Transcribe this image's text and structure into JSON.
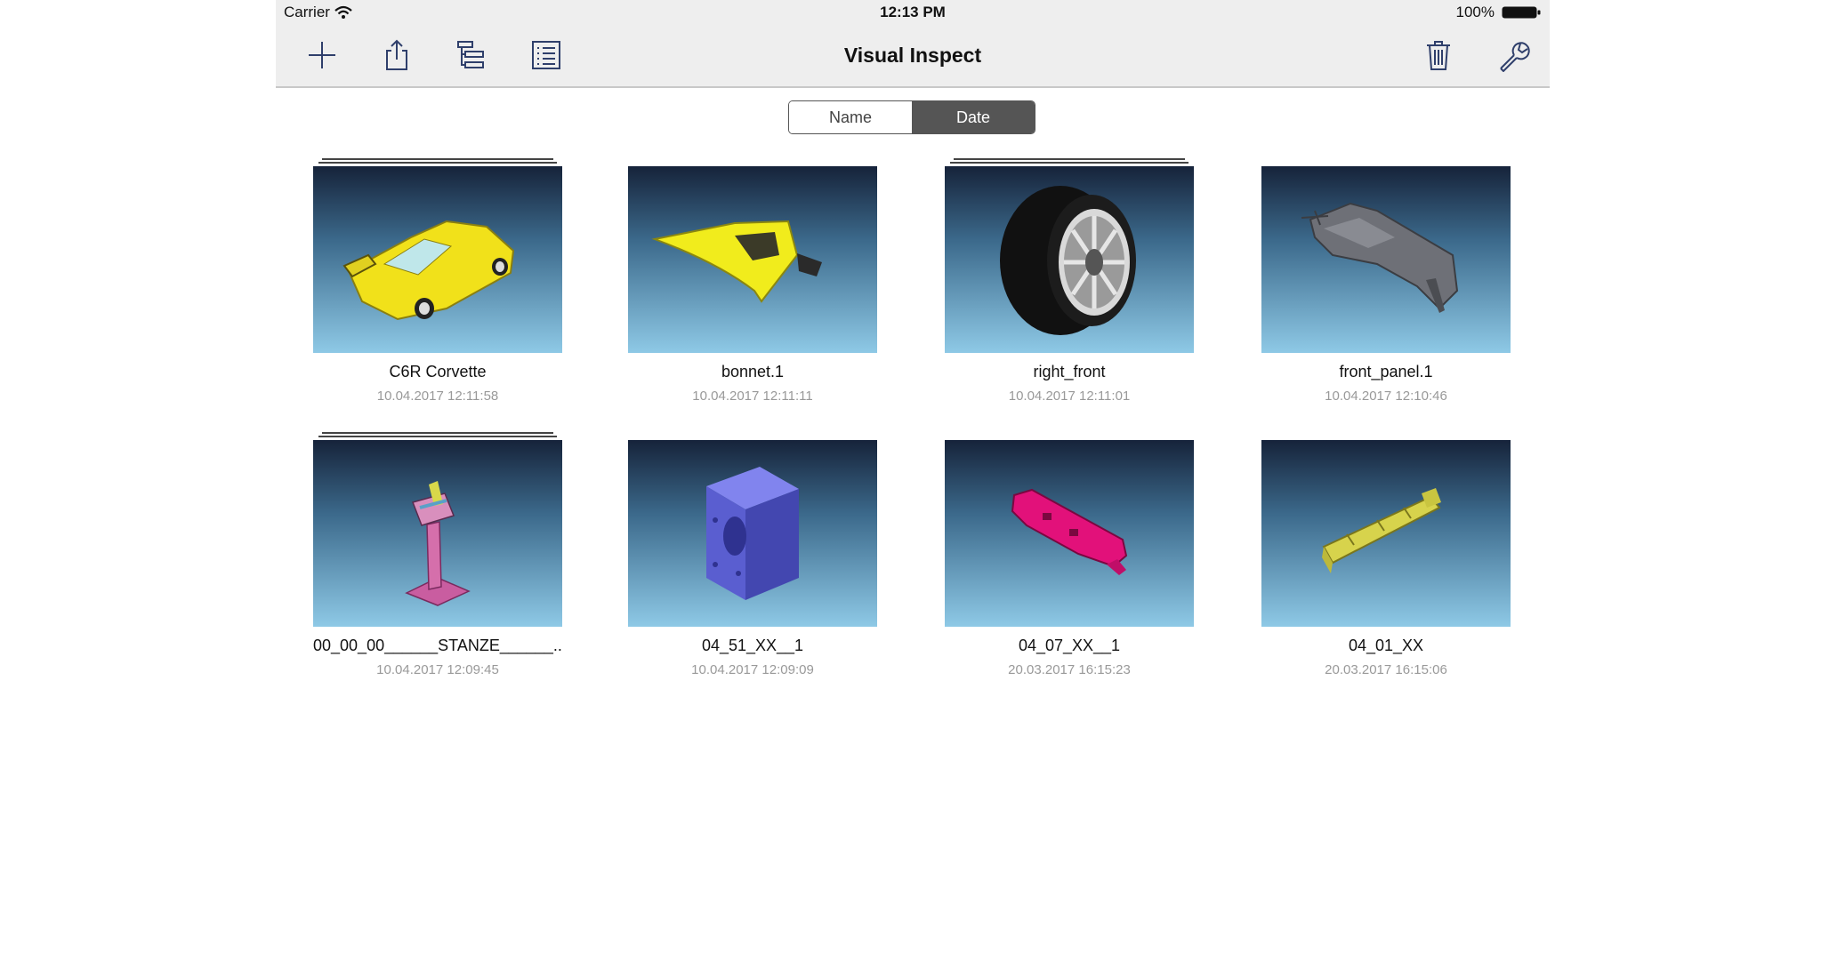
{
  "status_bar": {
    "carrier": "Carrier",
    "time": "12:13 PM",
    "battery": "100%"
  },
  "toolbar": {
    "title": "Visual Inspect",
    "left_icons": [
      "plus-icon",
      "share-icon",
      "tree-icon",
      "list-icon"
    ],
    "right_icons": [
      "trash-icon",
      "wrench-icon"
    ]
  },
  "sort": {
    "options": [
      "Name",
      "Date"
    ],
    "selected": "Date"
  },
  "files": [
    {
      "name": "C6R Corvette",
      "date": "10.04.2017 12:11:58",
      "is_assembly": true,
      "color": "#f2e218"
    },
    {
      "name": "bonnet.1",
      "date": "10.04.2017 12:11:11",
      "is_assembly": false,
      "color": "#f2ec1c"
    },
    {
      "name": "right_front",
      "date": "10.04.2017 12:11:01",
      "is_assembly": true,
      "color": "#111111"
    },
    {
      "name": "front_panel.1",
      "date": "10.04.2017 12:10:46",
      "is_assembly": false,
      "color": "#707278"
    },
    {
      "name": "00_00_00______STANZE______...",
      "date": "10.04.2017 12:09:45",
      "is_assembly": true,
      "color": "#d06fa8"
    },
    {
      "name": "04_51_XX__1",
      "date": "10.04.2017 12:09:09",
      "is_assembly": false,
      "color": "#6b6fd8"
    },
    {
      "name": "04_07_XX__1",
      "date": "20.03.2017 16:15:23",
      "is_assembly": false,
      "color": "#e0106e"
    },
    {
      "name": "04_01_XX",
      "date": "20.03.2017 16:15:06",
      "is_assembly": false,
      "color": "#d6d24a"
    }
  ]
}
